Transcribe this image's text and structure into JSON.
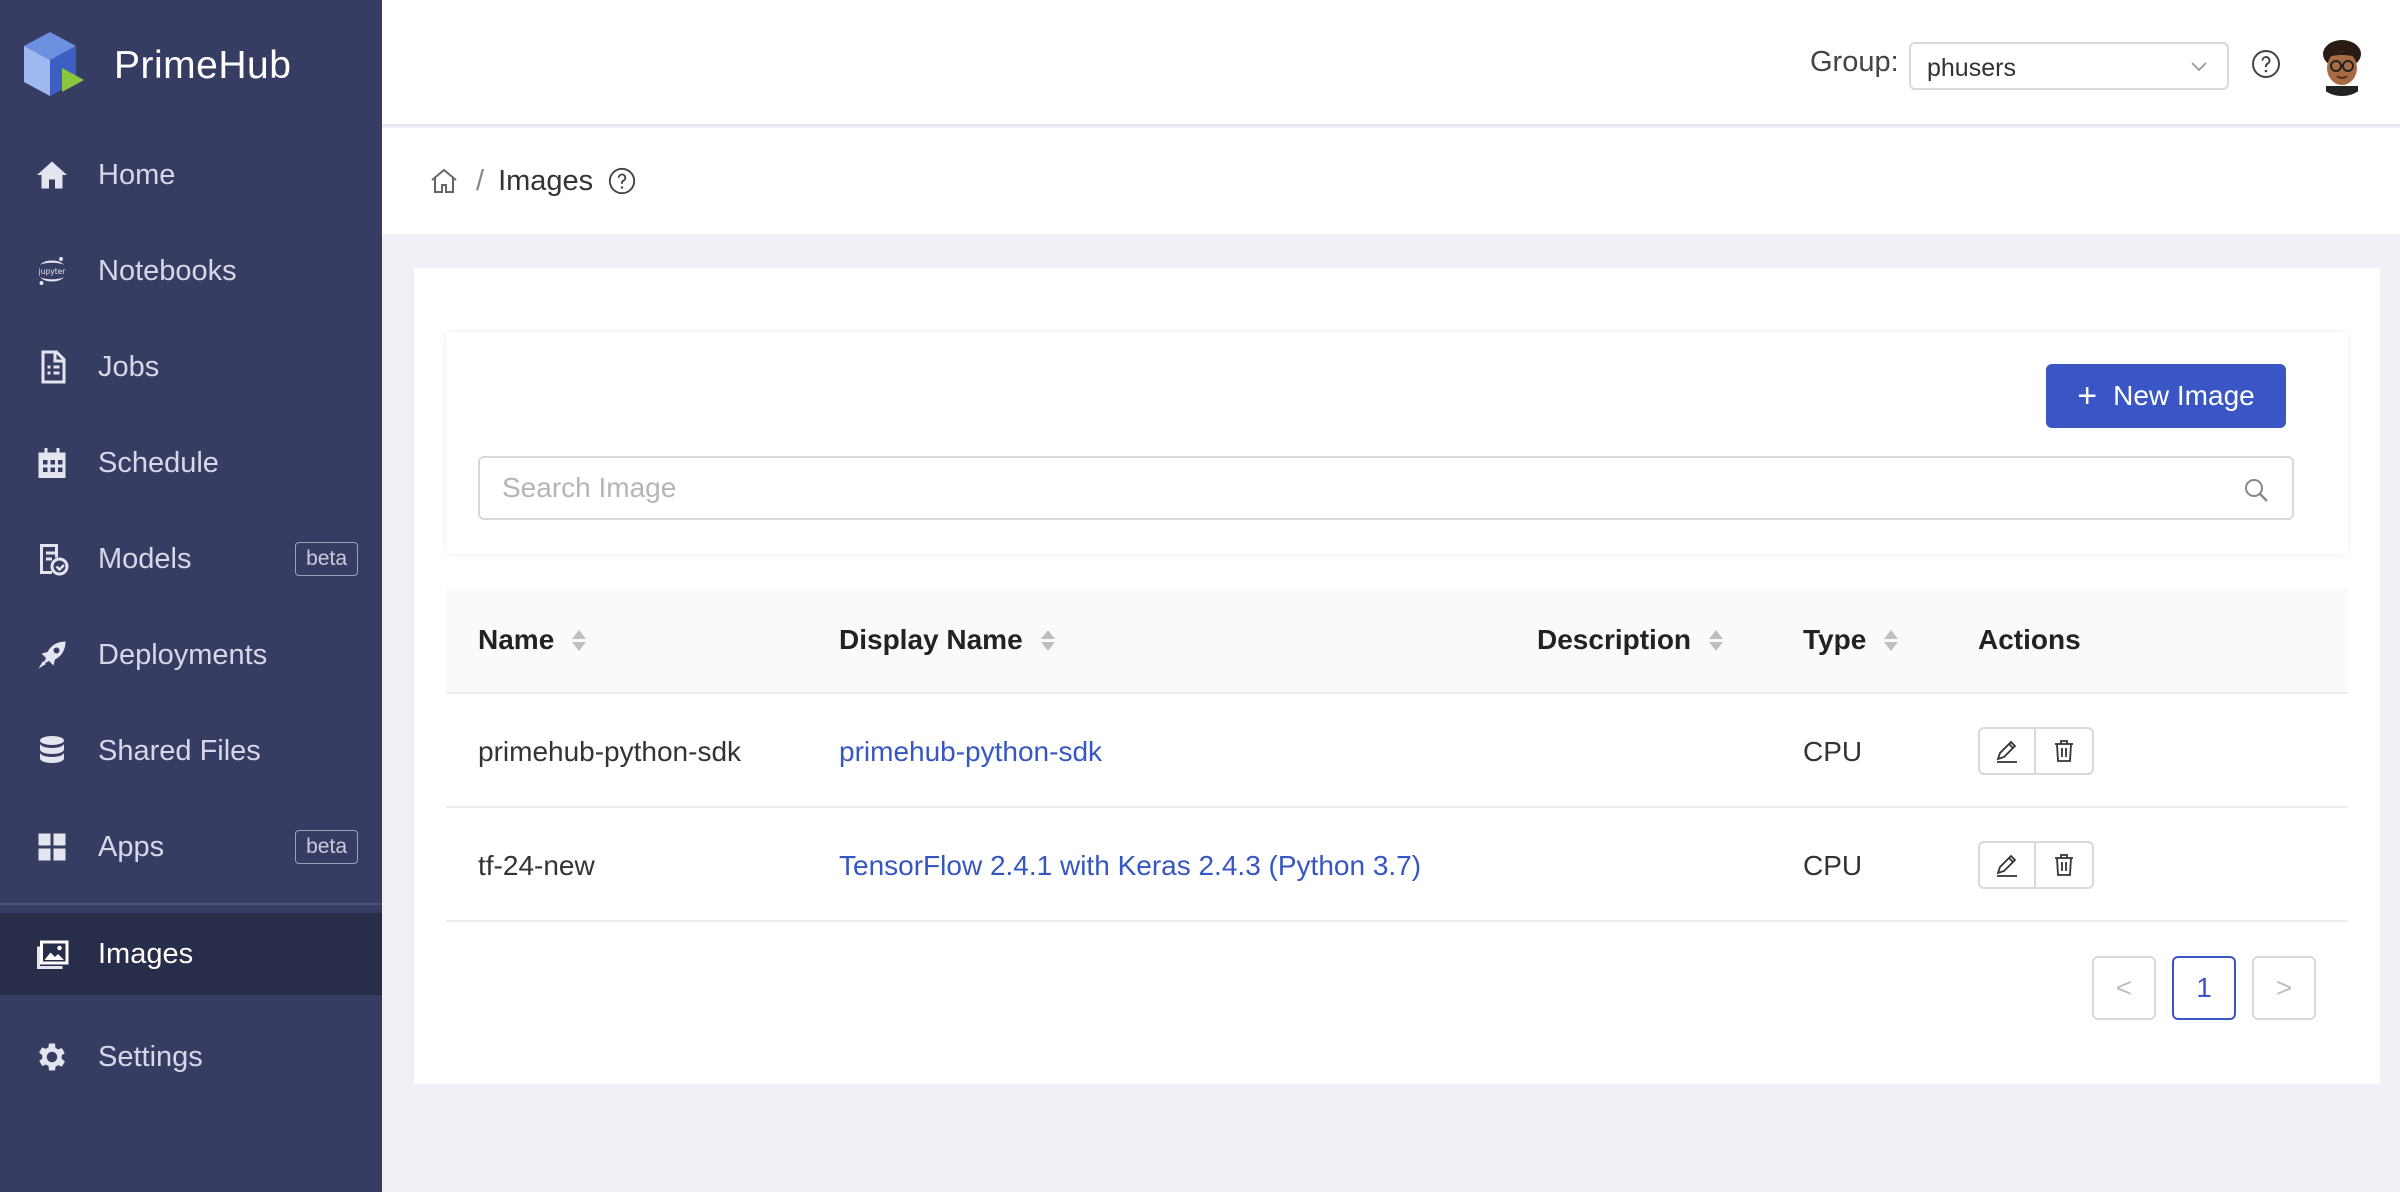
{
  "app": {
    "name": "PrimeHub"
  },
  "sidebar": {
    "items": [
      {
        "label": "Home",
        "icon": "home-icon"
      },
      {
        "label": "Notebooks",
        "icon": "jupyter-icon"
      },
      {
        "label": "Jobs",
        "icon": "jobs-icon"
      },
      {
        "label": "Schedule",
        "icon": "calendar-icon"
      },
      {
        "label": "Models",
        "icon": "models-icon",
        "badge": "beta"
      },
      {
        "label": "Deployments",
        "icon": "rocket-icon"
      },
      {
        "label": "Shared Files",
        "icon": "database-icon"
      },
      {
        "label": "Apps",
        "icon": "apps-icon",
        "badge": "beta"
      },
      {
        "label": "Images",
        "icon": "images-icon",
        "active": true
      },
      {
        "label": "Settings",
        "icon": "gear-icon"
      }
    ]
  },
  "header": {
    "group_label": "Group:",
    "group_value": "phusers"
  },
  "breadcrumb": {
    "title": "Images",
    "separator": "/"
  },
  "toolbar": {
    "new_button": "New Image",
    "search_placeholder": "Search Image"
  },
  "table": {
    "columns": [
      "Name",
      "Display Name",
      "Description",
      "Type",
      "Actions"
    ],
    "rows": [
      {
        "name": "primehub-python-sdk",
        "display_name": "primehub-python-sdk",
        "description": "",
        "type": "CPU"
      },
      {
        "name": "tf-24-new",
        "display_name": "TensorFlow 2.4.1 with Keras 2.4.3 (Python 3.7)",
        "description": "",
        "type": "CPU"
      }
    ]
  },
  "pagination": {
    "current": "1",
    "prev": "<",
    "next": ">"
  },
  "colors": {
    "sidebar": "#373d62",
    "sidebar_active": "#282d4a",
    "primary": "#3a56c4",
    "link": "#3656c2"
  }
}
